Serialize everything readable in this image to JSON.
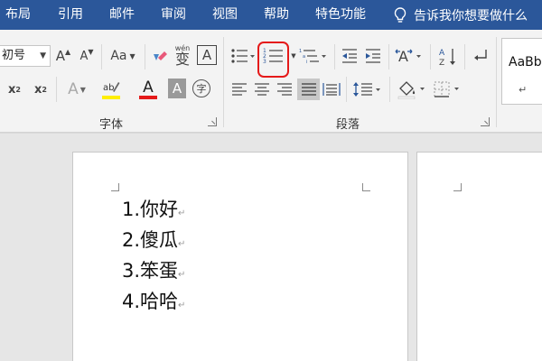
{
  "menu": {
    "tabs": [
      "布局",
      "引用",
      "邮件",
      "审阅",
      "视图",
      "帮助",
      "特色功能"
    ],
    "tell_me": "告诉我你想要做什么"
  },
  "ribbon": {
    "font_size": "初号",
    "font_group_label": "字体",
    "paragraph_group_label": "段落",
    "wen_char": "wén",
    "bian_char": "变",
    "a_char": "A",
    "zi_char": "字",
    "grow_font": "A",
    "shrink_font": "A",
    "change_case": "Aa",
    "style_sample": "AaBb",
    "style_mark": "↵"
  },
  "document": {
    "list_items": [
      "1.你好",
      "2.傻瓜",
      "3.笨蛋",
      "4.哈哈"
    ],
    "paragraph_mark": "↵"
  },
  "colors": {
    "title_bar": "#2b579a",
    "highlight_ring": "#e51a1a",
    "font_color_red": "#e51a1a",
    "highlight_yellow": "#ffee00"
  }
}
